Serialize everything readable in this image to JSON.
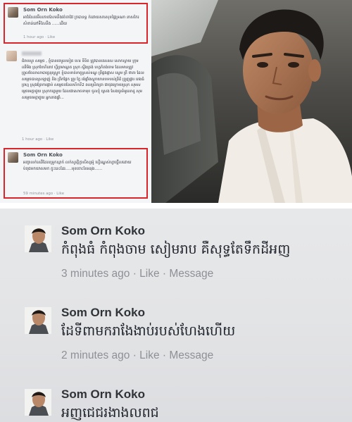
{
  "top_comments": [
    {
      "name": "Som Orn Koko",
      "text": "អាវ័រសៃរមើលភាពសែមនឹងវត់ចាវែវ ក្របានទ្ធ ក់ដោយសារសុខផ្ទៃទ្រណា នាសកៃរ សំខាន់នៅទឹសែនឹង ......ដើយ",
      "time": "1 hour ago",
      "like": "Like"
    },
    {
      "name": "",
      "text": "ជំរាបសួរ សម្ភេច , ខ្ញុំបានចោរួលខៀត ហេរ ទីនិត ត្រូវបានគេសរស សោកស្ដាយ ក្រុម ឈឹមិង ស្រុកបែហិនេាវ ហ្វីត្រមាណ្ហត ស្រុក ស្ទឹងត្រង់ ខេត្តកំពង់ចាម ដែលមានត្រូវព្រួលចែលាលាបាច្ឆេនុរស្ទ្រូក ខ្ញុំបានទាត់ទាតួស្រស់ទណ្ឌ ព្រីផ្តងផ្ដាស ស្ទេម ត្រី ថាតា ដែលសម្ភេចបានស្រឡាញ់ និង ព្រីកផ្ដែក ព្រួរ ក្ទៃ រង់ផ្តាំងស្ដុកយានបទបស់ព្រីដំ ព្រួញផ្ដារ ពេងធំ ព្រហ្ម ស្រុងព្រែការផ្ដាប់ សម្ដេចតនែលហិកទី2 ពលស្រិតត្រា ជាចុងក្រោយស្រុក សុមសម្តេចមេត្តាជួយ ស្រុកកត្តេមួយ ដែលជាសោចទាមុខ ចូលខ្ញុំ ស្រេង សែងចូរទំអូលោដូ សុមសម្ដេចមេត្តាជួយ អ្នកនាងផ្ទាំ...",
      "time": "1 hour ago",
      "like": "Like"
    },
    {
      "name": "Som Orn Koko",
      "text": "អញ្ចាលក់ឈើដែលទ្រូកស្មាក់ លក់សូរត្តិក្លាសិស្សម៉ូ ហ្វើណ្ឌេស់ហ្វាច្ឆើលដោយ ប់ពុជមកយាសមក ក្ទុះនេះដែរ.....មុខចោះខែអនុង......",
      "time": "59 minutes ago",
      "like": "Like"
    }
  ],
  "bottom_comments": [
    {
      "name": "Som Orn Koko",
      "text": "កំពុងធំ កំពុងចាម សៀមរាប គឺសុទ្ធតែទឹកដីអញ",
      "time": "3 minutes ago",
      "like": "Like",
      "message": "Message"
    },
    {
      "name": "Som Orn Koko",
      "text": "ដែទីពាមករាងែងាប់របស់ហែងហើយ",
      "time": "2 minutes ago",
      "like": "Like",
      "message": "Message"
    },
    {
      "name": "Som Orn Koko",
      "text": "អញជេជរងាងលពជ",
      "time": "",
      "like": "",
      "message": ""
    }
  ],
  "separator": "·",
  "colors": {
    "highlight_border": "#d9262c",
    "name_text": "#4b4f56",
    "meta_text": "#90949c"
  }
}
